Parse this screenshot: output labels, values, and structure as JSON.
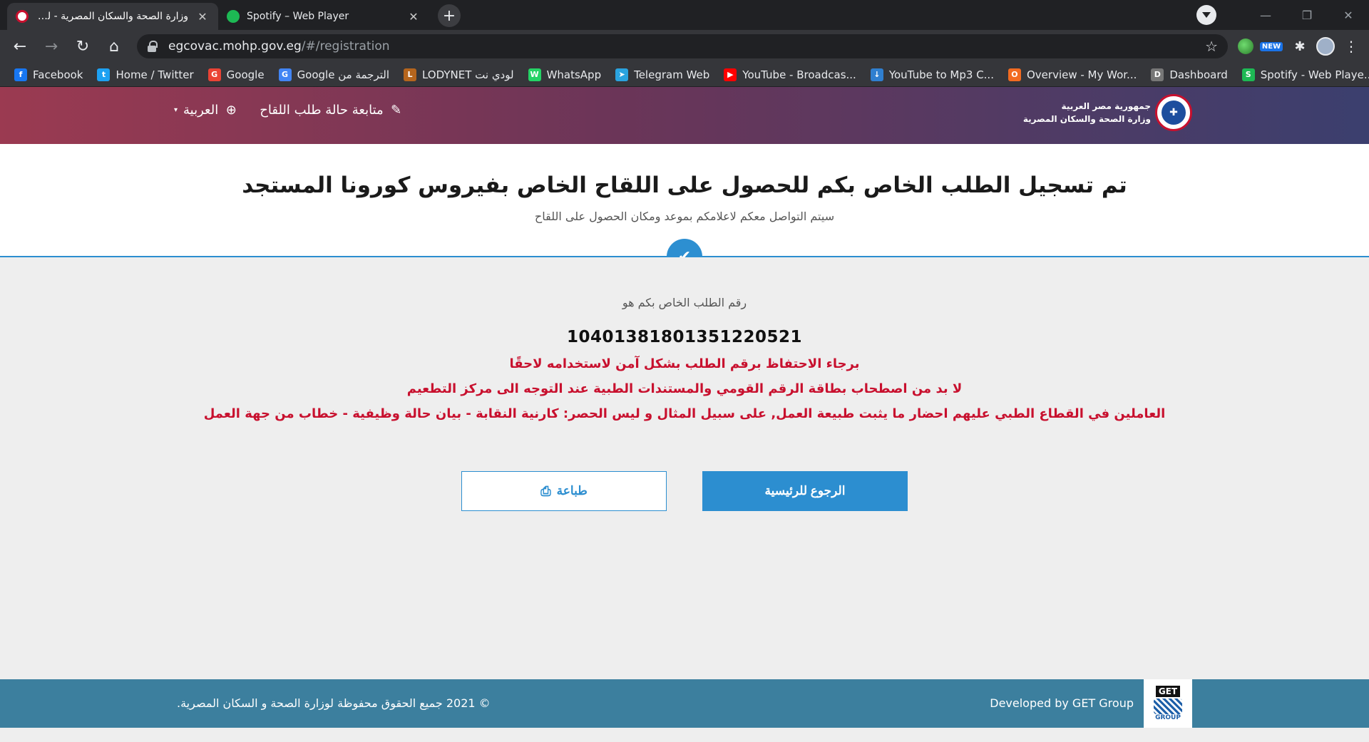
{
  "browser": {
    "tabs": [
      {
        "title": "وزارة الصحة والسكان المصرية - لقاح",
        "favicon_color": "#c8102e",
        "active": true
      },
      {
        "title": "Spotify – Web Player",
        "favicon_color": "#1db954",
        "active": false
      }
    ],
    "new_tab_label": "+",
    "window": {
      "minimize": "—",
      "restore": "❐",
      "close": "✕"
    },
    "url_host": "egcovac.mohp.gov.eg",
    "url_path": "/#/registration",
    "bookmarks": [
      {
        "label": "Facebook",
        "icon": "facebook-icon",
        "color": "#1877f2",
        "glyph": "f"
      },
      {
        "label": "Home / Twitter",
        "icon": "twitter-icon",
        "color": "#1da1f2",
        "glyph": "t"
      },
      {
        "label": "Google",
        "icon": "google-icon",
        "color": "#ea4335",
        "glyph": "G"
      },
      {
        "label": "Google الترجمة من",
        "icon": "google-translate-icon",
        "color": "#4285f4",
        "glyph": "G"
      },
      {
        "label": "LODYNET لودي نت",
        "icon": "lodynet-icon",
        "color": "#b5651d",
        "glyph": "L"
      },
      {
        "label": "WhatsApp",
        "icon": "whatsapp-icon",
        "color": "#25d366",
        "glyph": "W"
      },
      {
        "label": "Telegram Web",
        "icon": "telegram-icon",
        "color": "#2aa3df",
        "glyph": "➤"
      },
      {
        "label": "YouTube - Broadcas...",
        "icon": "youtube-icon",
        "color": "#ff0000",
        "glyph": "▶"
      },
      {
        "label": "YouTube to Mp3 C...",
        "icon": "download-icon",
        "color": "#2f7fd0",
        "glyph": "↓"
      },
      {
        "label": "Overview - My Wor...",
        "icon": "overview-icon",
        "color": "#f26b21",
        "glyph": "O"
      },
      {
        "label": "Dashboard",
        "icon": "dashboard-icon",
        "color": "#777777",
        "glyph": "D"
      },
      {
        "label": "Spotify - Web Playe...",
        "icon": "spotify-icon",
        "color": "#1db954",
        "glyph": "S"
      }
    ],
    "bookmarks_more": "»"
  },
  "header": {
    "brand_line1": "جمهورية مصر العربية",
    "brand_line2": "وزارة الصحة والسكان المصرية",
    "track_label": "متابعة حالة طلب اللقاح",
    "language_label": "العربية"
  },
  "main": {
    "title": "تم تسجيل الطلب الخاص بكم للحصول على اللقاح الخاص بفيروس كورونا المستجد",
    "subtitle": "سيتم التواصل معكم لاعلامكم بموعد ومكان الحصول على اللقاح",
    "request_label": "رقم الطلب الخاص بكم هو",
    "request_number": "10401381801351220521",
    "notices": [
      "برجاء الاحتفاظ برقم الطلب بشكل آمن لاستخدامه لاحقًا",
      "لا بد من اصطحاب بطاقة الرقم القومي والمستندات الطبية عند التوجه الى مركز التطعيم",
      "العاملين في القطاع الطبي عليهم احضار ما يثبت طبيعة العمل, على سبيل المثال و ليس الحصر: كارنية النقابة - بيان حالة وظيفية - خطاب من جهة العمل"
    ],
    "home_button": "الرجوع للرئيسية",
    "print_button": "طباعة"
  },
  "footer": {
    "copyright": "© 2021 جميع الحقوق محفوظة لوزارة الصحة و السكان المصرية.",
    "developer": "Developed by GET Group",
    "logo_top": "GET",
    "logo_bottom": "GROUP"
  },
  "colors": {
    "accent": "#2c8ed0",
    "alert": "#c8102e",
    "footer": "#3c7f9e"
  }
}
